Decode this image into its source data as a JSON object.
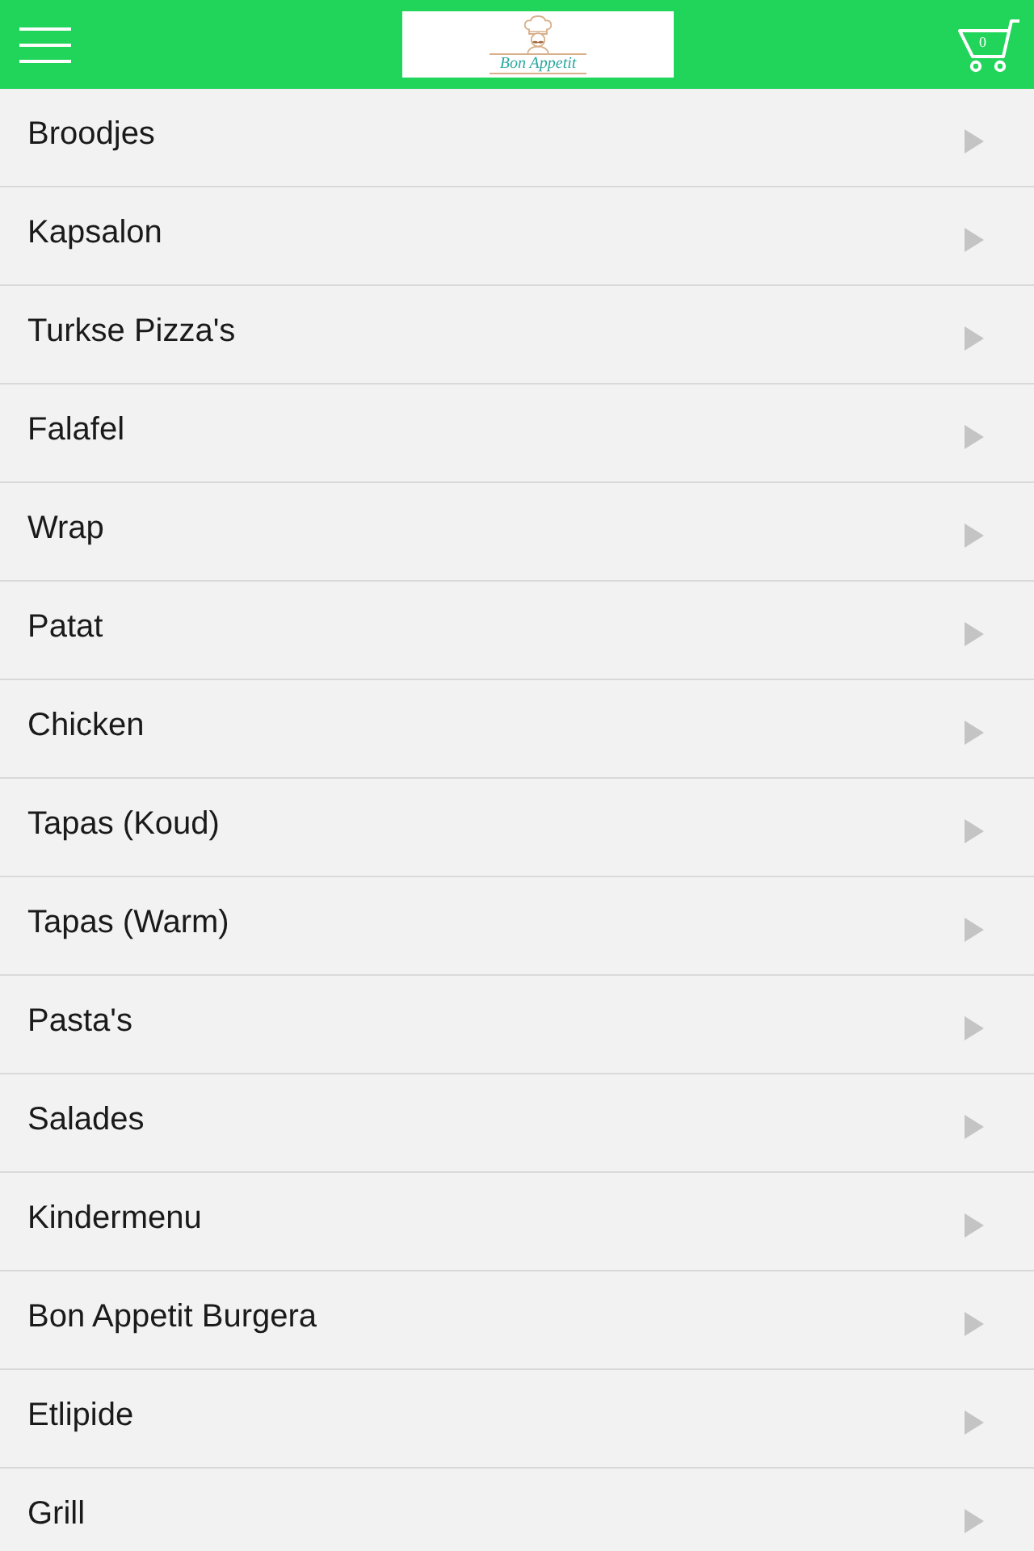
{
  "header": {
    "logo_text": "Bon Appetit",
    "cart_count": "0"
  },
  "categories": [
    {
      "label": "Broodjes"
    },
    {
      "label": "Kapsalon"
    },
    {
      "label": "Turkse Pizza's"
    },
    {
      "label": "Falafel"
    },
    {
      "label": "Wrap"
    },
    {
      "label": "Patat"
    },
    {
      "label": "Chicken"
    },
    {
      "label": "Tapas (Koud)"
    },
    {
      "label": "Tapas (Warm)"
    },
    {
      "label": "Pasta's"
    },
    {
      "label": "Salades"
    },
    {
      "label": "Kindermenu"
    },
    {
      "label": "Bon Appetit Burgera"
    },
    {
      "label": "Etlipide"
    },
    {
      "label": "Grill"
    }
  ]
}
